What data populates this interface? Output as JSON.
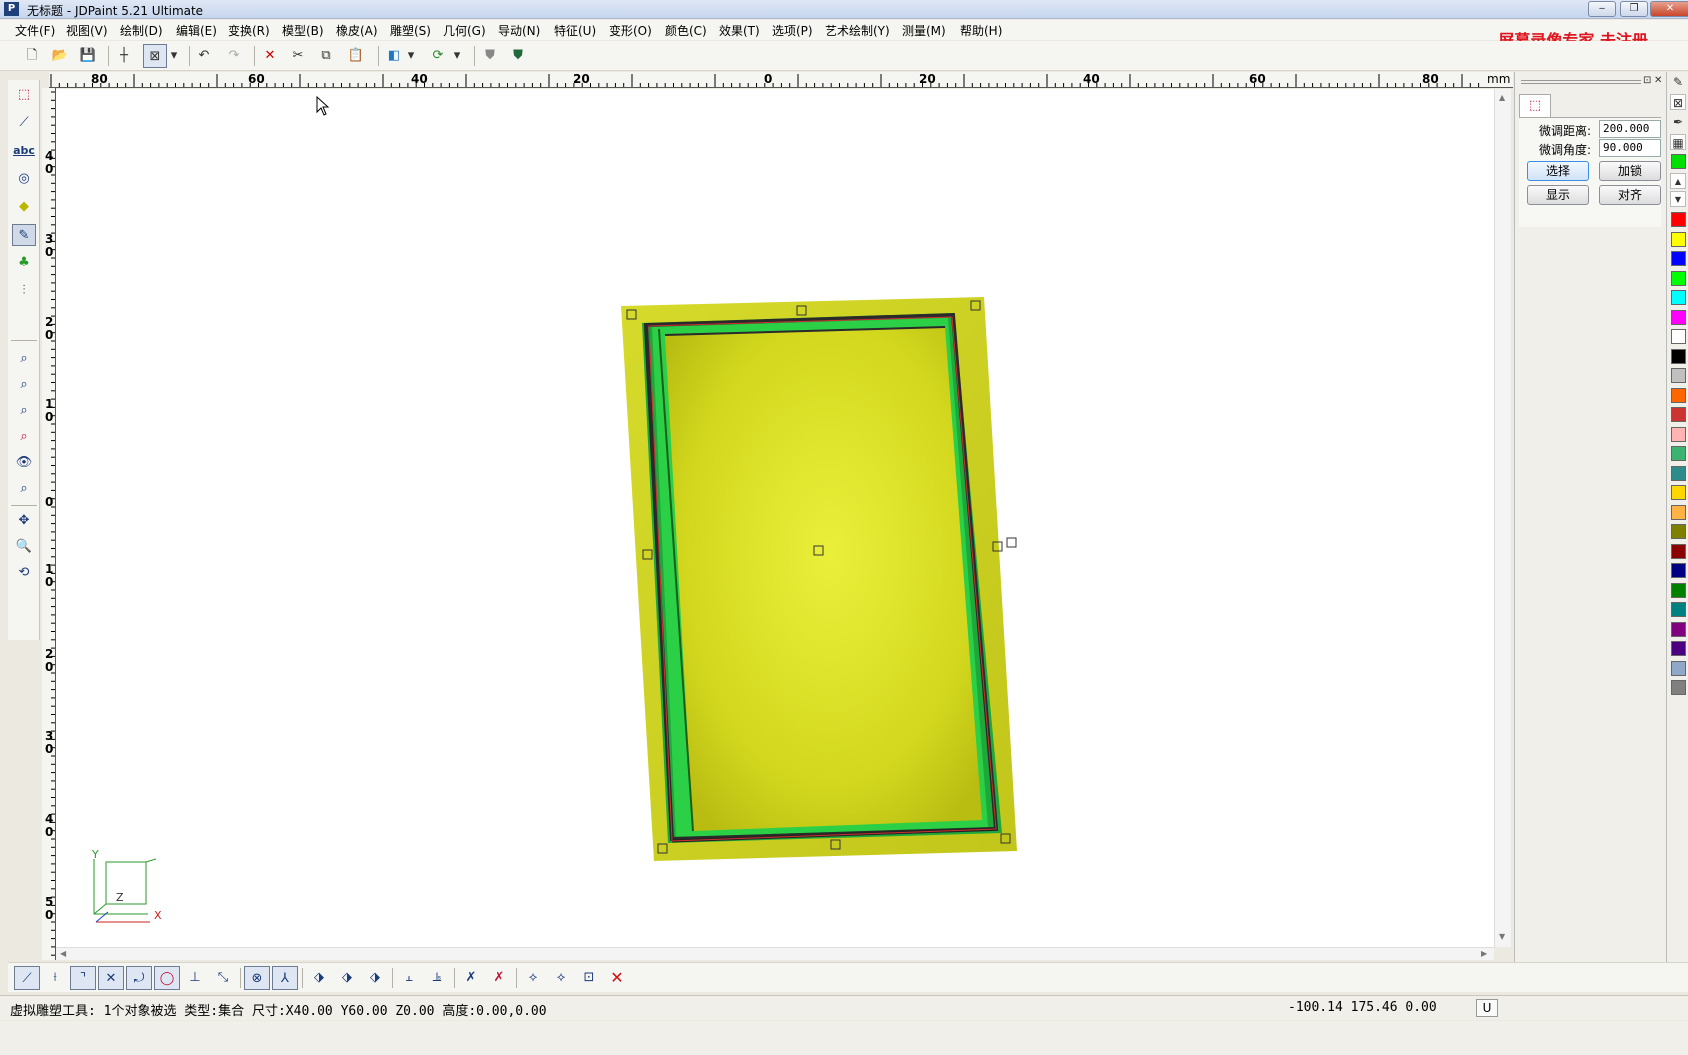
{
  "window": {
    "title": "无标题 - JDPaint 5.21 Ultimate",
    "app_icon": "P",
    "controls": {
      "minimize": "‒",
      "restore": "❐",
      "close": "✕"
    }
  },
  "menu": [
    "文件(F)",
    "视图(V)",
    "绘制(D)",
    "编辑(E)",
    "变换(R)",
    "模型(B)",
    "橡皮(A)",
    "雕塑(S)",
    "几何(G)",
    "导动(N)",
    "特征(U)",
    "变形(O)",
    "颜色(C)",
    "效果(T)",
    "选项(P)",
    "艺术绘制(Y)",
    "测量(M)",
    "帮助(H)"
  ],
  "watermark": "屏幕录像专家  未注册",
  "ruler": {
    "top_labels": [
      "80",
      "60",
      "40",
      "20",
      "0",
      "20",
      "40",
      "60",
      "80"
    ],
    "unit": "mm",
    "left_labels": [
      "4\n0",
      "3\n0",
      "2\n0",
      "1\n0",
      "0",
      "1\n0",
      "2\n0",
      "3\n0",
      "4\n0",
      "5\n0"
    ]
  },
  "axis_indicator": {
    "y": "Y",
    "x": "X",
    "z": "Z"
  },
  "panel": {
    "fine_distance_label": "微调距离:",
    "fine_distance_value": "200.000",
    "fine_angle_label": "微调角度:",
    "fine_angle_value": "90.000",
    "buttons": {
      "select": "选择",
      "lock": "加锁",
      "show": "显示",
      "align": "对齐"
    }
  },
  "palette_colors": [
    "#ff0000",
    "#ffff00",
    "#0000ff",
    "#00ff00",
    "#00ffff",
    "#ff00ff",
    "#ffffff",
    "#000000",
    "#c0c0c0",
    "#ff6600",
    "#cc3333",
    "#ffb3b3",
    "#3cb371",
    "#2e8b8b",
    "#ffd700",
    "#ffb347",
    "#808000",
    "#8b0000",
    "#000080",
    "#008000",
    "#008080",
    "#800080",
    "#4b0082",
    "#8fa8c8",
    "#808080"
  ],
  "status": {
    "message": "虚拟雕塑工具: 1个对象被选 类型:集合 尺寸:X40.00 Y60.00 Z0.00 高度:0.00,0.00",
    "coords": "-100.14 175.46 0.00",
    "unit_button": "U"
  }
}
